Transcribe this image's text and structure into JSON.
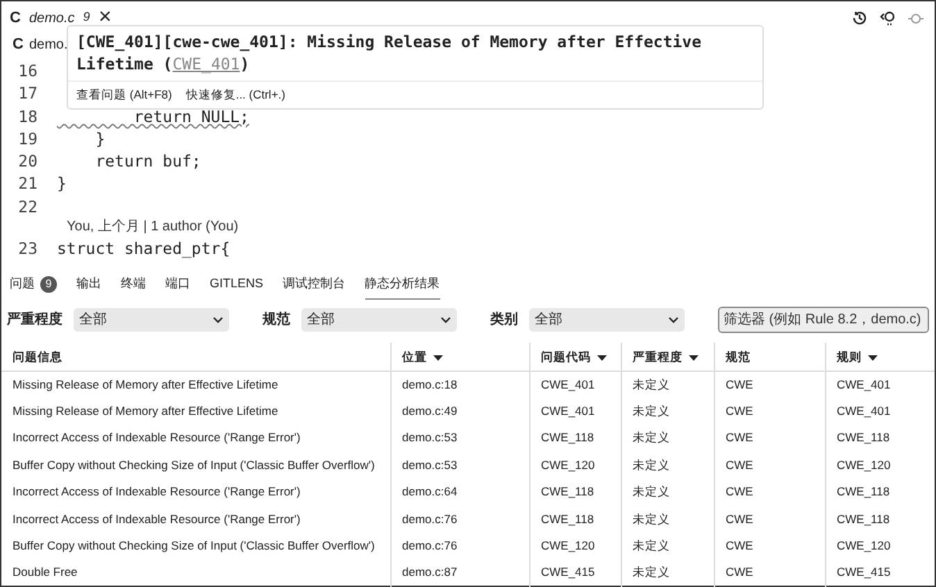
{
  "editor_tab": {
    "icon_letter": "C",
    "filename": "demo.c",
    "problem_count": "9",
    "close": "×",
    "selected": true
  },
  "breadcrumb": {
    "icon_letter": "C",
    "text": "demo."
  },
  "code_lines": [
    {
      "kind": "code",
      "number": "16"
    },
    {
      "kind": "code",
      "number": "17"
    },
    {
      "kind": "code",
      "number": "18",
      "text": "        return NULL;",
      "squiggle": true
    },
    {
      "kind": "code",
      "number": "19",
      "text": "    }",
      "squiggle": false
    },
    {
      "kind": "code",
      "number": "20",
      "text": "    return buf;",
      "squiggle": false
    },
    {
      "kind": "code",
      "number": "21",
      "text": "}",
      "squiggle": false
    },
    {
      "kind": "code",
      "number": "22"
    },
    {
      "kind": "codelens",
      "text": "You, 上个月 | 1 author (You)"
    },
    {
      "kind": "code",
      "number": "23",
      "text": "struct shared_ptr{",
      "squiggle": false
    }
  ],
  "hover": {
    "message_before": "[CWE_401][cwe-cwe_401]: Missing Release of Memory after Effective Lifetime (",
    "link": "CWE_401",
    "message_after": ")",
    "actions": [
      "查看问题 (Alt+F8)",
      "快速修复... (Ctrl+.)"
    ]
  },
  "panel_tabs": [
    {
      "label": "问题",
      "badge": "9",
      "selected": false
    },
    {
      "label": "输出",
      "selected": false
    },
    {
      "label": "终端",
      "selected": false
    },
    {
      "label": "端口",
      "selected": false
    },
    {
      "label": "GITLENS",
      "selected": false
    },
    {
      "label": "调试控制台",
      "selected": false
    },
    {
      "label": "静态分析结果",
      "selected": true
    }
  ],
  "filters": [
    {
      "label": "严重程度",
      "value": "全部"
    },
    {
      "label": "规范",
      "value": "全部"
    },
    {
      "label": "类别",
      "value": "全部"
    }
  ],
  "filter_field": {
    "placeholder": "筛选器 (例如 Rule 8.2，demo.c)"
  },
  "table": {
    "columns": [
      {
        "label": "问题信息",
        "sortable": false
      },
      {
        "label": "位置",
        "sortable": true
      },
      {
        "label": "问题代码",
        "sortable": true
      },
      {
        "label": "严重程度",
        "sortable": true
      },
      {
        "label": "规范",
        "sortable": false
      },
      {
        "label": "规则",
        "sortable": true
      }
    ],
    "rows": [
      [
        "Missing Release of Memory after Effective Lifetime",
        "demo.c:18",
        "CWE_401",
        "未定义",
        "CWE",
        "CWE_401"
      ],
      [
        "Missing Release of Memory after Effective Lifetime",
        "demo.c:49",
        "CWE_401",
        "未定义",
        "CWE",
        "CWE_401"
      ],
      [
        "Incorrect Access of Indexable Resource ('Range Error')",
        "demo.c:53",
        "CWE_118",
        "未定义",
        "CWE",
        "CWE_118"
      ],
      [
        "Buffer Copy without Checking Size of Input ('Classic Buffer Overflow')",
        "demo.c:53",
        "CWE_120",
        "未定义",
        "CWE",
        "CWE_120"
      ],
      [
        "Incorrect Access of Indexable Resource ('Range Error')",
        "demo.c:64",
        "CWE_118",
        "未定义",
        "CWE",
        "CWE_118"
      ],
      [
        "Incorrect Access of Indexable Resource ('Range Error')",
        "demo.c:76",
        "CWE_118",
        "未定义",
        "CWE",
        "CWE_118"
      ],
      [
        "Buffer Copy without Checking Size of Input ('Classic Buffer Overflow')",
        "demo.c:76",
        "CWE_120",
        "未定义",
        "CWE",
        "CWE_120"
      ],
      [
        "Double Free",
        "demo.c:87",
        "CWE_415",
        "未定义",
        "CWE",
        "CWE_415"
      ]
    ]
  }
}
